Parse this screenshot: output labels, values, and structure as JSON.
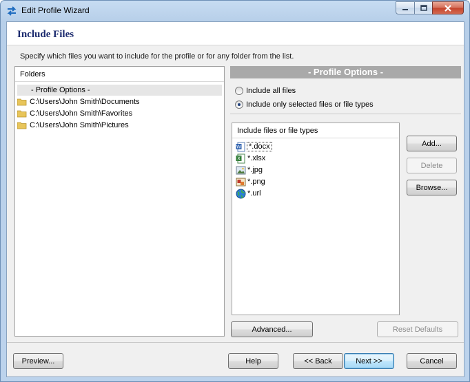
{
  "window": {
    "title": "Edit Profile Wizard",
    "accent": "#1b2a6e"
  },
  "titlebar_buttons": {
    "minimize_icon": "minimize-icon",
    "maximize_icon": "maximize-icon",
    "close_icon": "close-icon"
  },
  "page": {
    "title": "Include Files",
    "description": "Specify which files you want to include for the profile or for any folder from the list."
  },
  "folders": {
    "header": "Folders",
    "items": [
      {
        "label": "- Profile Options -",
        "icon": "none",
        "selected": true
      },
      {
        "label": "C:\\Users\\John Smith\\Documents",
        "icon": "folder-icon"
      },
      {
        "label": "C:\\Users\\John Smith\\Favorites",
        "icon": "folder-icon"
      },
      {
        "label": "C:\\Users\\John Smith\\Pictures",
        "icon": "folder-icon"
      }
    ]
  },
  "profile_options": {
    "header": "- Profile Options -",
    "radio_all": "Include all files",
    "radio_selected": "Include only selected files or file types",
    "selected_option": "radio_selected"
  },
  "file_types": {
    "header": "Include files or file types",
    "items": [
      {
        "label": "*.docx",
        "icon": "word-document-icon"
      },
      {
        "label": "*.xlsx",
        "icon": "excel-spreadsheet-icon"
      },
      {
        "label": "*.jpg",
        "icon": "jpg-image-icon"
      },
      {
        "label": "*.png",
        "icon": "png-image-icon"
      },
      {
        "label": "*.url",
        "icon": "globe-url-icon"
      }
    ]
  },
  "side_buttons": {
    "add": "Add...",
    "delete": "Delete",
    "browse": "Browse..."
  },
  "lower_buttons": {
    "advanced": "Advanced...",
    "reset_defaults": "Reset Defaults"
  },
  "footer": {
    "preview": "Preview...",
    "help": "Help",
    "back": "<< Back",
    "next": "Next >>",
    "cancel": "Cancel"
  }
}
